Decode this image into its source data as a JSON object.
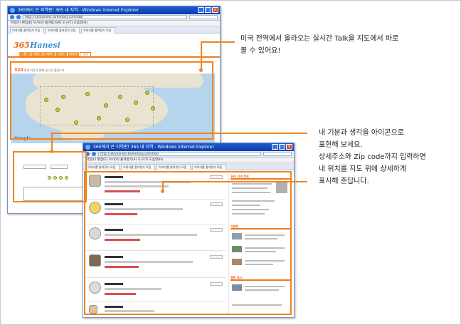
{
  "browser_back": {
    "title": "365에서 큰 지역판! 365 내 지역 - Windows Internet Explorer",
    "url": "http://365hanesi.tomedaily.com/tab/",
    "menu": "파일(F)  편집(E)  보기(V)  즐겨찾기(A)  도구(T)  도움말(H)",
    "tabs": [
      "이야기를 즐겨찾기 모음",
      "이야기를 즐겨찾기 모음",
      "이야기를 즐겨찾기 모음"
    ],
    "site_logo_main": "365",
    "site_logo_sub": "Hanesi",
    "gnb": [
      "홈",
      "메인",
      "지역",
      "공감",
      "이야기",
      "검색"
    ],
    "map_bar_count": "320",
    "map_bar_text": "명의 이웃이 현재 실시간 중입니다",
    "map_brand": "Google"
  },
  "browser_front": {
    "title": "365에서 큰 지역판! 365 내 지역 - Windows Internet Explorer",
    "url": "http://365hanesi.tomedaily.com/tab/",
    "menu": "파일(F)  편집(E)  보기(V)  즐겨찾기(A)  도구(T)  도움말(H)",
    "tabs": [
      "이야기를 즐겨찾기 모음",
      "이야기를 즐겨찾기 모음",
      "이야기를 즐겨찾기 모음",
      "이야기를 즐겨찾기 모음"
    ],
    "side_heads": [
      "365 지역 정보",
      "이벤트",
      "관련 게시"
    ]
  },
  "callouts": {
    "map": [
      "미국 전역에서 올라오는 실시간 Talk을 지도에서 바로",
      "볼 수 있어요!"
    ],
    "post": [
      "내 기분과 생각을 아이콘으로",
      "표현해 보세요.",
      "상세주소와 Zip code까지 입력하면",
      "내 위치를 지도 위에 상세하게",
      "표시해 준답니다."
    ]
  },
  "colors": {
    "accent": "#f2841f",
    "map_water": "#b6d4ec",
    "pin": "#b7d53a"
  }
}
